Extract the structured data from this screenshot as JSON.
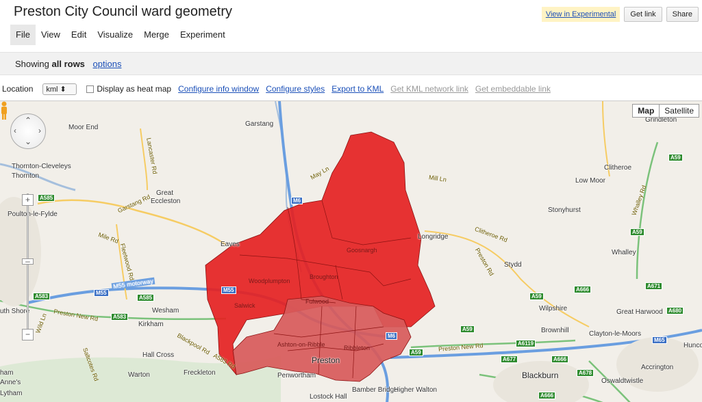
{
  "title": "Preston City Council ward geometry",
  "header": {
    "experimental": "View in Experimental",
    "get_link": "Get link",
    "share": "Share"
  },
  "menu": [
    "File",
    "View",
    "Edit",
    "Visualize",
    "Merge",
    "Experiment"
  ],
  "rows": {
    "prefix": "Showing",
    "bold": "all rows",
    "options": "options"
  },
  "toolbar": {
    "location_label": "Location",
    "location_value": "kml",
    "heatmap": "Display as heat map",
    "info_window": "Configure info window",
    "styles": "Configure styles",
    "export": "Export to KML",
    "network_link": "Get KML network link",
    "embed": "Get embeddable link"
  },
  "map": {
    "map_btn": "Map",
    "satellite_btn": "Satellite",
    "fill_color": "#e52222",
    "urban_fill_color": "#d96060",
    "places": {
      "garstang": "Garstang",
      "moor_end": "Moor End",
      "thornton_cleveleys": "Thornton-Cleveleys",
      "thornton": "Thornton",
      "poulton": "Poulton-le-Fylde",
      "great_eccleston": "Great Eccleston",
      "great": "Great",
      "eccleston": "Eccleston",
      "eaves": "Eaves",
      "woodplumpton": "Woodplumpton",
      "broughton": "Broughton",
      "goosnargh": "Goosnargh",
      "longridge": "Longridge",
      "fulwood": "Fulwood",
      "salwick": "Salwick",
      "wesham": "Wesham",
      "kirkham": "Kirkham",
      "south_shore": "uth Shore",
      "hall_cross": "Hall Cross",
      "warton": "Warton",
      "freckleton": "Freckleton",
      "ashton": "Ashton-on-Ribble",
      "ribbleton": "Ribbleton",
      "preston": "Preston",
      "penwortham": "Penwortham",
      "lostock_hall": "Lostock Hall",
      "bamber_bridge": "Bamber Bridge",
      "higher_walton": "Higher Walton",
      "st_annes": "Anne's",
      "clitheroe": "Clitheroe",
      "low_moor": "Low Moor",
      "stonyhurst": "Stonyhurst",
      "grindleton": "Grindleton",
      "whalley": "Whalley",
      "stydd": "Stydd",
      "wilpshire": "Wilpshire",
      "great_harwood": "Great Harwood",
      "clayton": "Clayton-le-Moors",
      "brownhill": "Brownhill",
      "blackburn": "Blackburn",
      "accrington": "Accrington",
      "oswaldtwistle": "Oswaldtwistle",
      "hunco": "Hunco",
      "ham": "ham",
      "lytham": "Lytham"
    },
    "roads": {
      "m55": "M55 motorway",
      "may_ln": "May Ln",
      "mill_ln": "Mill Ln",
      "garstang_rd": "Garstang Rd",
      "lancaster_rd": "Lancaster Rd",
      "mile_rd": "Mile Rd",
      "fleetwood_rd": "Fleetwood Rd",
      "preston_new_rd": "Preston New Rd",
      "wild_ln": "Wild Ln",
      "blackpool_rd": "Blackpool Rd",
      "saltcotes_rd": "Saltcotes Rd",
      "clitheroe_rd": "Clitheroe Rd",
      "preston_rd": "Preston Rd",
      "whalley_rd": "Whalley Rd",
      "preston_new_rd_e": "Preston New Rd",
      "a583_rd": "A583 Rd",
      "bracewell": "Blackpool Rd"
    },
    "shields": {
      "a585": "A585",
      "a586": "A586",
      "a583": "A583",
      "a59": "A59",
      "m6": "M6",
      "m55": "M55",
      "a666": "A666",
      "a671": "A671",
      "a680": "A680",
      "a677": "A677",
      "a6119": "A6119",
      "a678": "A678",
      "m65": "M65",
      "b6245": "B6245"
    }
  }
}
